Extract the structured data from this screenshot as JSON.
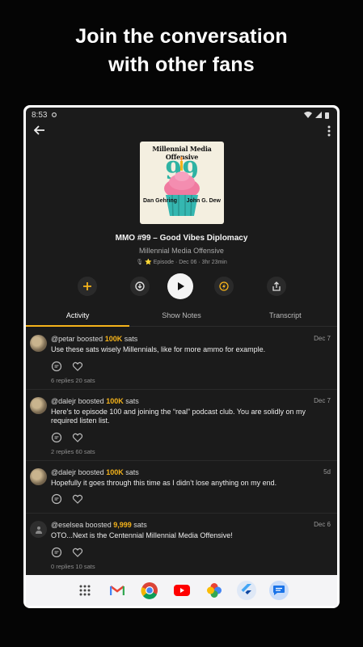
{
  "promo": {
    "line1": "Join the conversation",
    "line2": "with other fans"
  },
  "status_bar": {
    "time": "8:53"
  },
  "icons": {
    "back": "arrow-left-icon",
    "more": "more-vert-icon",
    "add": "plus-icon",
    "download": "download-icon",
    "play": "play-icon",
    "boost": "lightning-icon",
    "share": "share-icon",
    "reply": "comment-icon",
    "like": "heart-icon"
  },
  "artwork": {
    "title": "Millennial Media Offensive",
    "number": "99",
    "left_name": "Dan Gehring",
    "right_name": "John G. Dew"
  },
  "episode": {
    "title": "MMO #99 – Good Vibes Diplomacy",
    "show": "Millennial Media Offensive",
    "meta": "🎙 ⭐ Episode · Dec 06 · 3hr 23min"
  },
  "tabs": [
    {
      "label": "Activity"
    },
    {
      "label": "Show Notes"
    },
    {
      "label": "Transcript"
    }
  ],
  "activity": [
    {
      "user": "@petar",
      "verb": " boosted ",
      "amount": "100K",
      "unit": " sats",
      "date": "Dec 7",
      "text": "Use these sats wisely Millennials, like for more ammo for example.",
      "stats": "6 replies  20 sats"
    },
    {
      "user": "@dalejr",
      "verb": " boosted ",
      "amount": "100K",
      "unit": " sats",
      "date": "Dec 7",
      "text": "Here’s to episode 100 and joining the “real” podcast club. You are solidly on my required listen list.",
      "stats": "2 replies  60 sats"
    },
    {
      "user": "@dalejr",
      "verb": " boosted ",
      "amount": "100K",
      "unit": " sats",
      "date": "5d",
      "text": "Hopefully it goes through this time as I didn’t lose anything on my end.",
      "stats": ""
    },
    {
      "user": "@eselsea",
      "verb": " boosted ",
      "amount": "9,999",
      "unit": " sats",
      "date": "Dec 6",
      "text": "OTO...Next is the Centennial Millennial Media Offensive!",
      "stats": "0 replies  10 sats"
    }
  ],
  "dock": [
    "app-drawer-icon",
    "gmail-icon",
    "chrome-icon",
    "youtube-icon",
    "photos-icon",
    "flutter-icon",
    "messages-icon"
  ]
}
